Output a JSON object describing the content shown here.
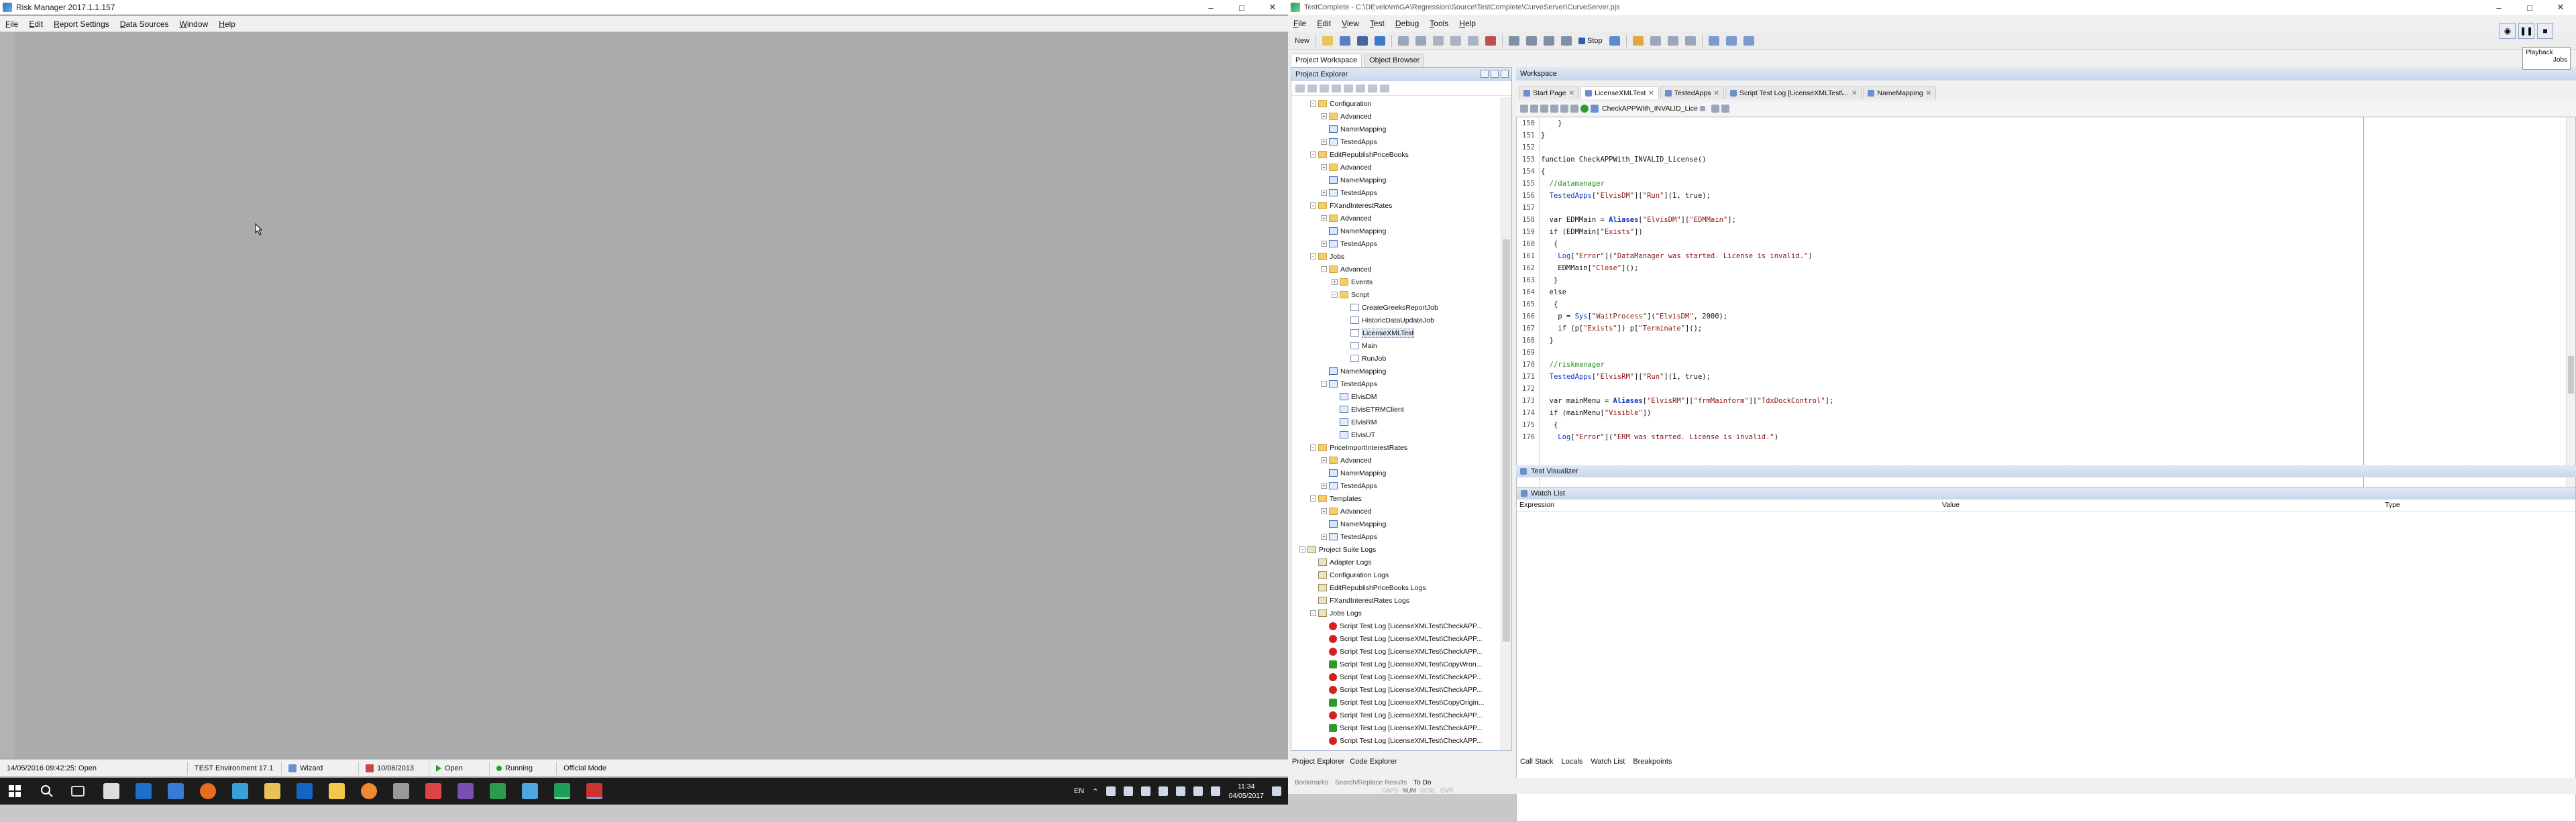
{
  "risk_manager": {
    "title": "Risk Manager 2017.1.1.157",
    "window_controls": [
      "–",
      "□",
      "✕"
    ],
    "menu": [
      "File",
      "Edit",
      "Report Settings",
      "Data Sources",
      "Window",
      "Help"
    ],
    "status": {
      "datetime": "14/05/2016 09:42:25: Open",
      "environment": "TEST Environment 17.1",
      "wizard": "Wizard",
      "date": "10/06/2013",
      "open": "Open",
      "running": "Running",
      "mode": "Official Mode"
    }
  },
  "testcomplete": {
    "title": "TestComplete - C:\\DEvelo\\m\\GA\\Regression\\Source\\TestComplete\\CurveServer\\CurveServer.pjs",
    "window_controls": [
      "–",
      "□",
      "✕"
    ],
    "menu": [
      "File",
      "Edit",
      "View",
      "Test",
      "Debug",
      "Tools",
      "Help"
    ],
    "toolbar": {
      "new_label": "New",
      "stop_label": "Stop"
    },
    "workspace_tabs": [
      "Project Workspace",
      "Object Browser"
    ],
    "project_explorer_title": "Project Explorer",
    "tree": [
      {
        "label": "Configuration",
        "indent": 1,
        "icon": "folder",
        "exp": "-"
      },
      {
        "label": "Advanced",
        "indent": 2,
        "icon": "folder",
        "exp": "+"
      },
      {
        "label": "NameMapping",
        "indent": 2,
        "icon": "nm",
        "exp": ""
      },
      {
        "label": "TestedApps",
        "indent": 2,
        "icon": "grid",
        "exp": "+"
      },
      {
        "label": "EditRepublishPriceBooks",
        "indent": 1,
        "icon": "folder",
        "exp": "-"
      },
      {
        "label": "Advanced",
        "indent": 2,
        "icon": "folder",
        "exp": "+"
      },
      {
        "label": "NameMapping",
        "indent": 2,
        "icon": "nm",
        "exp": ""
      },
      {
        "label": "TestedApps",
        "indent": 2,
        "icon": "grid",
        "exp": "+"
      },
      {
        "label": "FXandInterestRates",
        "indent": 1,
        "icon": "folder",
        "exp": "-"
      },
      {
        "label": "Advanced",
        "indent": 2,
        "icon": "folder",
        "exp": "+"
      },
      {
        "label": "NameMapping",
        "indent": 2,
        "icon": "nm",
        "exp": ""
      },
      {
        "label": "TestedApps",
        "indent": 2,
        "icon": "grid",
        "exp": "+"
      },
      {
        "label": "Jobs",
        "indent": 1,
        "icon": "folder",
        "exp": "-"
      },
      {
        "label": "Advanced",
        "indent": 2,
        "icon": "folder",
        "exp": "-"
      },
      {
        "label": "Events",
        "indent": 3,
        "icon": "folder",
        "exp": "+"
      },
      {
        "label": "Script",
        "indent": 3,
        "icon": "folder",
        "exp": "-"
      },
      {
        "label": "CreateGreeksReportJob",
        "indent": 4,
        "icon": "doc",
        "exp": ""
      },
      {
        "label": "HistoricDataUpdateJob",
        "indent": 4,
        "icon": "doc",
        "exp": ""
      },
      {
        "label": "LicenseXMLTest",
        "indent": 4,
        "icon": "doc",
        "exp": "",
        "selected": true
      },
      {
        "label": "Main",
        "indent": 4,
        "icon": "doc",
        "exp": ""
      },
      {
        "label": "RunJob",
        "indent": 4,
        "icon": "doc",
        "exp": ""
      },
      {
        "label": "NameMapping",
        "indent": 2,
        "icon": "nm",
        "exp": ""
      },
      {
        "label": "TestedApps",
        "indent": 2,
        "icon": "grid",
        "exp": "-"
      },
      {
        "label": "ElvisDM",
        "indent": 3,
        "icon": "grid",
        "exp": ""
      },
      {
        "label": "ElvisETRMClient",
        "indent": 3,
        "icon": "grid",
        "exp": ""
      },
      {
        "label": "ElvisRM",
        "indent": 3,
        "icon": "grid",
        "exp": ""
      },
      {
        "label": "ElvisUT",
        "indent": 3,
        "icon": "grid",
        "exp": ""
      },
      {
        "label": "PriceImportInterestRates",
        "indent": 1,
        "icon": "folder",
        "exp": "-"
      },
      {
        "label": "Advanced",
        "indent": 2,
        "icon": "folder",
        "exp": "+"
      },
      {
        "label": "NameMapping",
        "indent": 2,
        "icon": "nm",
        "exp": ""
      },
      {
        "label": "TestedApps",
        "indent": 2,
        "icon": "grid",
        "exp": "+"
      },
      {
        "label": "Templates",
        "indent": 1,
        "icon": "folder",
        "exp": "-"
      },
      {
        "label": "Advanced",
        "indent": 2,
        "icon": "folder",
        "exp": "+"
      },
      {
        "label": "NameMapping",
        "indent": 2,
        "icon": "nm",
        "exp": ""
      },
      {
        "label": "TestedApps",
        "indent": 2,
        "icon": "grid",
        "exp": "+"
      },
      {
        "label": "Project Suite Logs",
        "indent": 0,
        "icon": "logs",
        "exp": "-"
      },
      {
        "label": "Adapter Logs",
        "indent": 1,
        "icon": "logs",
        "exp": ""
      },
      {
        "label": "Configuration Logs",
        "indent": 1,
        "icon": "logs",
        "exp": ""
      },
      {
        "label": "EditRepublishPriceBooks Logs",
        "indent": 1,
        "icon": "logs",
        "exp": ""
      },
      {
        "label": "FXandInterestRates Logs",
        "indent": 1,
        "icon": "logs",
        "exp": ""
      },
      {
        "label": "Jobs Logs",
        "indent": 1,
        "icon": "logs",
        "exp": "-"
      },
      {
        "label": "Script Test Log [LicenseXMLTest\\CheckAPP...",
        "indent": 2,
        "icon": "err",
        "exp": ""
      },
      {
        "label": "Script Test Log [LicenseXMLTest\\CheckAPP...",
        "indent": 2,
        "icon": "err",
        "exp": ""
      },
      {
        "label": "Script Test Log [LicenseXMLTest\\CheckAPP...",
        "indent": 2,
        "icon": "err",
        "exp": ""
      },
      {
        "label": "Script Test Log [LicenseXMLTest\\CopyWron...",
        "indent": 2,
        "icon": "ok",
        "exp": ""
      },
      {
        "label": "Script Test Log [LicenseXMLTest\\CheckAPP...",
        "indent": 2,
        "icon": "err",
        "exp": ""
      },
      {
        "label": "Script Test Log [LicenseXMLTest\\CheckAPP...",
        "indent": 2,
        "icon": "err",
        "exp": ""
      },
      {
        "label": "Script Test Log [LicenseXMLTest\\CopyOrigin...",
        "indent": 2,
        "icon": "ok",
        "exp": ""
      },
      {
        "label": "Script Test Log [LicenseXMLTest\\CheckAPP...",
        "indent": 2,
        "icon": "err",
        "exp": ""
      },
      {
        "label": "Script Test Log [LicenseXMLTest\\CheckAPP...",
        "indent": 2,
        "icon": "ok",
        "exp": ""
      },
      {
        "label": "Script Test Log [LicenseXMLTest\\CheckAPP...",
        "indent": 2,
        "icon": "err",
        "exp": ""
      },
      {
        "label": "Script Test Log [LicenseXMLTest\\CheckAPP...",
        "indent": 2,
        "icon": "err",
        "exp": ""
      }
    ],
    "workspace_title": "Workspace",
    "editor_tabs": [
      {
        "label": "Start Page",
        "active": false
      },
      {
        "label": "LicenseXMLTest",
        "active": true
      },
      {
        "label": "TestedApps",
        "active": false
      },
      {
        "label": "Script Test Log [LicenseXMLTest\\...",
        "active": false
      },
      {
        "label": "NameMapping",
        "active": false
      }
    ],
    "routine_selector": "CheckAPPWith_INVALID_Lice",
    "code_lines": [
      {
        "n": "150",
        "html": "    }"
      },
      {
        "n": "151",
        "html": "}"
      },
      {
        "n": "152",
        "html": ""
      },
      {
        "n": "153",
        "html": "function CheckAPPWith_INVALID_License()"
      },
      {
        "n": "154",
        "html": "{"
      },
      {
        "n": "155",
        "html": "  <span class=\"cm\">//datamanager</span>"
      },
      {
        "n": "156",
        "html": "  <span class=\"id\">TestedApps</span>[<span class=\"str\">\"ElvisDM\"</span>][<span class=\"str\">\"Run\"</span>](1, true);"
      },
      {
        "n": "157",
        "html": ""
      },
      {
        "n": "158",
        "html": "  var EDMMain = <span class=\"al\">Aliases</span>[<span class=\"str\">\"ElvisDM\"</span>][<span class=\"str\">\"EDMMain\"</span>];"
      },
      {
        "n": "159",
        "html": "  if (EDMMain[<span class=\"str\">\"Exists\"</span>])"
      },
      {
        "n": "160",
        "html": "   {"
      },
      {
        "n": "161",
        "html": "    <span class=\"id\">Log</span>[<span class=\"str\">\"Error\"</span>](<span class=\"str\">\"DataManager was started. License is invalid.\"</span>)"
      },
      {
        "n": "162",
        "html": "    EDMMain[<span class=\"str\">\"Close\"</span>]();"
      },
      {
        "n": "163",
        "html": "   }"
      },
      {
        "n": "164",
        "html": "  else"
      },
      {
        "n": "165",
        "html": "   {"
      },
      {
        "n": "166",
        "html": "    p = <span class=\"id\">Sys</span>[<span class=\"str\">\"WaitProcess\"</span>](<span class=\"str\">\"ElvisDM\"</span>, 2000);"
      },
      {
        "n": "167",
        "html": "    if (p[<span class=\"str\">\"Exists\"</span>]) p[<span class=\"str\">\"Terminate\"</span>]();"
      },
      {
        "n": "168",
        "html": "  }"
      },
      {
        "n": "169",
        "html": ""
      },
      {
        "n": "170",
        "html": "  <span class=\"cm\">//riskmanager</span>"
      },
      {
        "n": "171",
        "html": "  <span class=\"id\">TestedApps</span>[<span class=\"str\">\"ElvisRM\"</span>][<span class=\"str\">\"Run\"</span>](1, true);"
      },
      {
        "n": "172",
        "html": ""
      },
      {
        "n": "173",
        "html": "  var mainMenu = <span class=\"al\">Aliases</span>[<span class=\"str\">\"ElvisRM\"</span>][<span class=\"str\">\"frmMainform\"</span>][<span class=\"str\">\"TdxDockControl\"</span>];"
      },
      {
        "n": "174",
        "html": "  if (mainMenu[<span class=\"str\">\"Visible\"</span>])"
      },
      {
        "n": "175",
        "html": "   {"
      },
      {
        "n": "176",
        "html": "    <span class=\"id\">Log</span>[<span class=\"str\">\"Error\"</span>](<span class=\"str\">\"ERM was started. License is invalid.\"</span>)"
      }
    ],
    "test_visualizer_title": "Test Visualizer",
    "watch_list_title": "Watch List",
    "watch_columns": [
      "Expression",
      "Value",
      "Type"
    ],
    "bottom_tabs_left": [
      "Project Explorer",
      "Code Explorer"
    ],
    "bottom_tabs_right": [
      "Call Stack",
      "Locals",
      "Watch List",
      "Breakpoints"
    ],
    "status_row1": [
      "Bookmarks",
      "Search/Replace Results",
      "To Do"
    ],
    "status_row2": [
      "CAPS",
      "NUM",
      "SCRL",
      "OVR"
    ],
    "playback_label": "Playback",
    "jobs_label": "Jobs"
  },
  "taskbar": {
    "lang": "EN",
    "time": "11:34",
    "date": "04/05/2017"
  },
  "colors": {
    "mdi_bg": "#ababab",
    "selection": "#dde8f7",
    "comment": "#1f8f1f",
    "string": "#8a1313",
    "identifier": "#0a34c4",
    "error_icon": "#d42020",
    "ok_icon": "#2e9a2e"
  }
}
